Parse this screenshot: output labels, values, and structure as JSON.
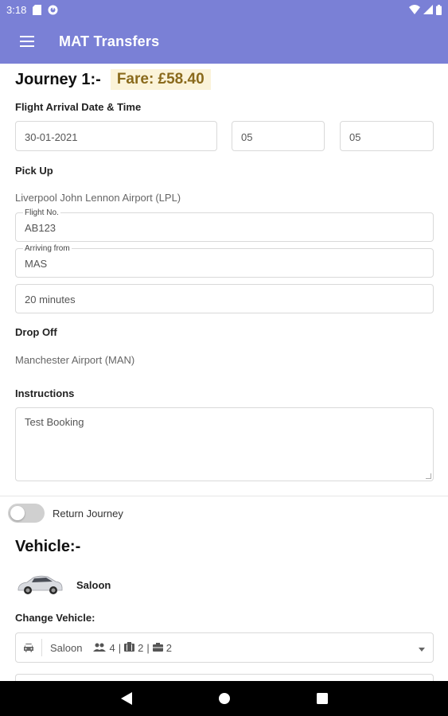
{
  "status_bar": {
    "time": "3:18",
    "icons": [
      "sd-card-icon",
      "sync-icon",
      "wifi-icon",
      "signal-icon",
      "battery-icon"
    ]
  },
  "app_bar": {
    "title": "MAT Transfers",
    "menu_icon": "hamburger-menu-icon"
  },
  "journey": {
    "title": "Journey 1:-",
    "fare": "Fare: £58.40",
    "arrival_label": "Flight Arrival Date & Time",
    "date_value": "30-01-2021",
    "hour_value": "05",
    "minute_value": "05",
    "pickup_label": "Pick Up",
    "pickup_location": "Liverpool John Lennon Airport (LPL)",
    "flight_no_label": "Flight No.",
    "flight_no_value": "AB123",
    "arriving_from_label": "Arriving from",
    "arriving_from_value": "MAS",
    "wait_value": "20 minutes",
    "dropoff_label": "Drop Off",
    "dropoff_location": "Manchester Airport (MAN)",
    "instructions_label": "Instructions",
    "instructions_value": "Test Booking"
  },
  "return_journey": {
    "label": "Return Journey",
    "enabled": false
  },
  "vehicle": {
    "title": "Vehicle:-",
    "selected_name": "Saloon",
    "change_label": "Change Vehicle:",
    "select": {
      "name": "Saloon",
      "passengers": "4",
      "luggage": "2",
      "hand_luggage": "2",
      "sep1": "|",
      "sep2": "|"
    }
  },
  "colors": {
    "primary": "#7a80d6",
    "fare_text": "#8a6a1c",
    "fare_bg": "#fbf3d9"
  }
}
